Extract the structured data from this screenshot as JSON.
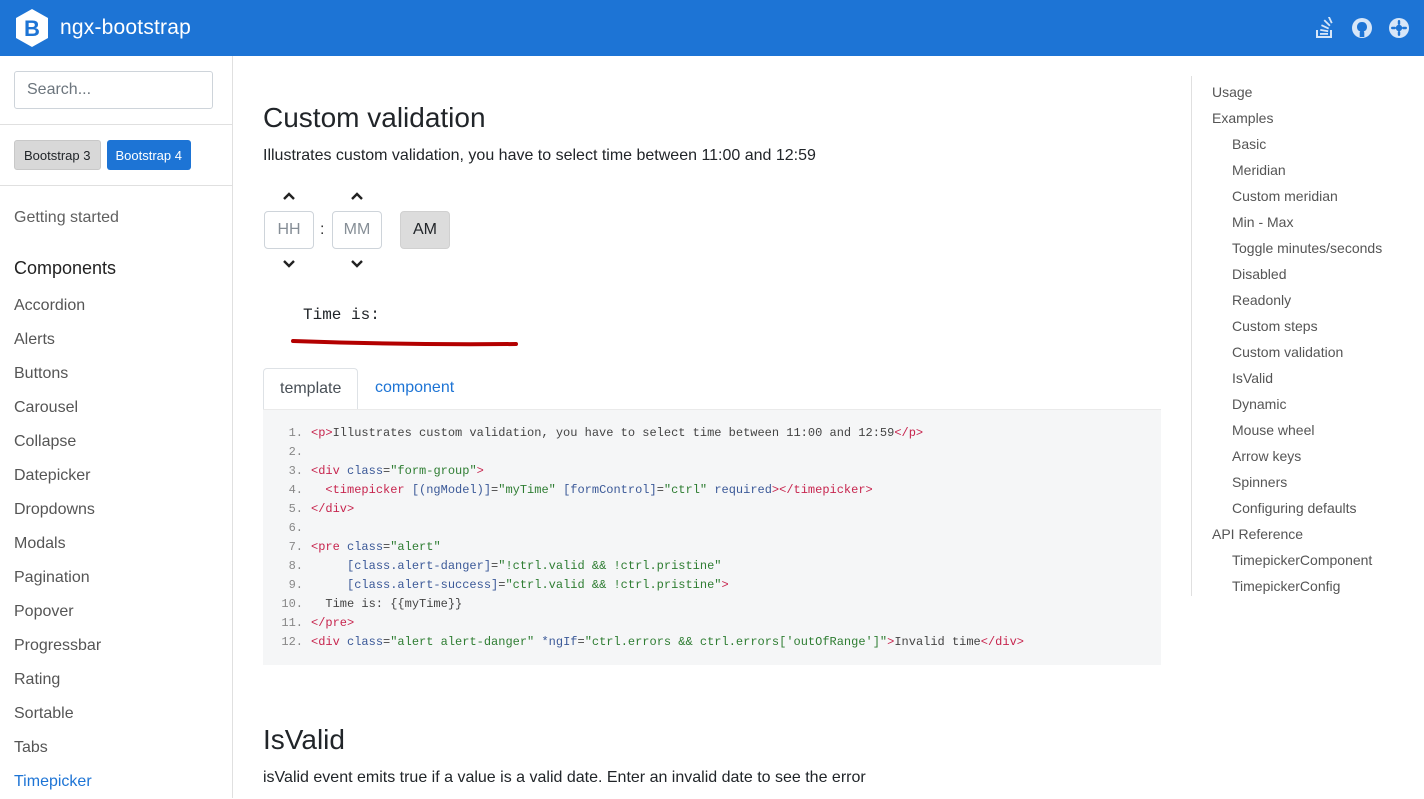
{
  "header": {
    "brand_letter": "B",
    "brand_name": "ngx-bootstrap",
    "icons": [
      "stackoverflow-icon",
      "github-icon",
      "slack-icon"
    ],
    "color": "#1d74d5"
  },
  "sidebar": {
    "search_placeholder": "Search...",
    "themes": [
      {
        "label": "Bootstrap 3",
        "active": false
      },
      {
        "label": "Bootstrap 4",
        "active": true
      }
    ],
    "getting_started": "Getting started",
    "components_heading": "Components",
    "items": [
      "Accordion",
      "Alerts",
      "Buttons",
      "Carousel",
      "Collapse",
      "Datepicker",
      "Dropdowns",
      "Modals",
      "Pagination",
      "Popover",
      "Progressbar",
      "Rating",
      "Sortable",
      "Tabs",
      "Timepicker"
    ],
    "active_item": "Timepicker"
  },
  "main": {
    "section1": {
      "title": "Custom validation",
      "description": "Illustrates custom validation, you have to select time between 11:00 and 12:59"
    },
    "timepicker": {
      "hours_placeholder": "HH",
      "minutes_placeholder": "MM",
      "separator": ":",
      "meridian": "AM"
    },
    "time_output": "Time is:",
    "tabs": [
      {
        "label": "template",
        "active": true
      },
      {
        "label": "component",
        "active": false
      }
    ],
    "code_lines": [
      [
        [
          "tg",
          "<p>"
        ],
        [
          "pl",
          "Illustrates custom validation, you have to select time between 11:00 and 12:59"
        ],
        [
          "tg",
          "</p>"
        ]
      ],
      [],
      [
        [
          "tg",
          "<div "
        ],
        [
          "at",
          "class"
        ],
        [
          "pl",
          "="
        ],
        [
          "st",
          "\"form-group\""
        ],
        [
          "tg",
          ">"
        ]
      ],
      [
        [
          "pl",
          "  "
        ],
        [
          "tg",
          "<timepicker "
        ],
        [
          "at",
          "[(ngModel)]"
        ],
        [
          "pl",
          "="
        ],
        [
          "st",
          "\"myTime\""
        ],
        [
          "pl",
          " "
        ],
        [
          "at",
          "[formControl]"
        ],
        [
          "pl",
          "="
        ],
        [
          "st",
          "\"ctrl\""
        ],
        [
          "pl",
          " "
        ],
        [
          "at",
          "required"
        ],
        [
          "tg",
          "></timepicker>"
        ]
      ],
      [
        [
          "tg",
          "</div>"
        ]
      ],
      [],
      [
        [
          "tg",
          "<pre "
        ],
        [
          "at",
          "class"
        ],
        [
          "pl",
          "="
        ],
        [
          "st",
          "\"alert\""
        ]
      ],
      [
        [
          "pl",
          "     "
        ],
        [
          "at",
          "[class.alert-danger]"
        ],
        [
          "pl",
          "="
        ],
        [
          "st",
          "\"!ctrl.valid && !ctrl.pristine\""
        ]
      ],
      [
        [
          "pl",
          "     "
        ],
        [
          "at",
          "[class.alert-success]"
        ],
        [
          "pl",
          "="
        ],
        [
          "st",
          "\"ctrl.valid && !ctrl.pristine\""
        ],
        [
          "tg",
          ">"
        ]
      ],
      [
        [
          "pl",
          "  Time is: {{myTime}}"
        ]
      ],
      [
        [
          "tg",
          "</pre>"
        ]
      ],
      [
        [
          "tg",
          "<div "
        ],
        [
          "at",
          "class"
        ],
        [
          "pl",
          "="
        ],
        [
          "st",
          "\"alert alert-danger\""
        ],
        [
          "pl",
          " "
        ],
        [
          "at",
          "*ngIf"
        ],
        [
          "pl",
          "="
        ],
        [
          "st",
          "\"ctrl.errors && ctrl.errors['outOfRange']\""
        ],
        [
          "tg",
          ">"
        ],
        [
          "pl",
          "Invalid time"
        ],
        [
          "tg",
          "</div>"
        ]
      ]
    ],
    "section2": {
      "title": "IsValid",
      "description": "isValid event emits true if a value is a valid date. Enter an invalid date to see the error"
    }
  },
  "toc": {
    "items": [
      {
        "label": "Usage",
        "level": 1
      },
      {
        "label": "Examples",
        "level": 1
      },
      {
        "label": "Basic",
        "level": 2
      },
      {
        "label": "Meridian",
        "level": 2
      },
      {
        "label": "Custom meridian",
        "level": 2
      },
      {
        "label": "Min - Max",
        "level": 2
      },
      {
        "label": "Toggle minutes/seconds",
        "level": 2
      },
      {
        "label": "Disabled",
        "level": 2
      },
      {
        "label": "Readonly",
        "level": 2
      },
      {
        "label": "Custom steps",
        "level": 2
      },
      {
        "label": "Custom validation",
        "level": 2
      },
      {
        "label": "IsValid",
        "level": 2
      },
      {
        "label": "Dynamic",
        "level": 2
      },
      {
        "label": "Mouse wheel",
        "level": 2
      },
      {
        "label": "Arrow keys",
        "level": 2
      },
      {
        "label": "Spinners",
        "level": 2
      },
      {
        "label": "Configuring defaults",
        "level": 2
      },
      {
        "label": "API Reference",
        "level": 1
      },
      {
        "label": "TimepickerComponent",
        "level": 2
      },
      {
        "label": "TimepickerConfig",
        "level": 2
      }
    ]
  }
}
